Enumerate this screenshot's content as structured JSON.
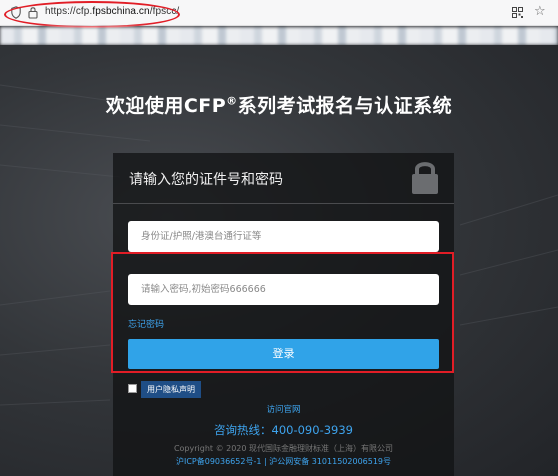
{
  "browser": {
    "url_prefix": "https://cfp.",
    "url_domain": "fpsbchina.cn",
    "url_path": "/fpscc/"
  },
  "page": {
    "headline_before": "欢迎使用CFP",
    "headline_reg": "®",
    "headline_after": "系列考试报名与认证系统"
  },
  "login": {
    "title": "请输入您的证件号和密码",
    "id_placeholder": "身份证/护照/港澳台通行证等",
    "password_placeholder": "请输入密码,初始密码666666",
    "forgot_label": "忘记密码",
    "submit_label": "登录",
    "privacy_label": "用户隐私声明"
  },
  "footer": {
    "visit_label": "访问官网",
    "hotline": "咨询热线：400-090-3939",
    "copyright": "Copyright © 2020 现代国际金融理财标准（上海）有限公司",
    "icp": "沪ICP备09036652号-1 | 沪公网安备 31011502006519号"
  },
  "colors": {
    "accent": "#30a3e8",
    "link": "#3ea4ee",
    "annotation_red": "#e11d26",
    "privacy_tag": "#1f4e86"
  },
  "icons": [
    "shield-icon",
    "lock-icon",
    "qr-code-icon",
    "star-icon",
    "padlock-icon"
  ]
}
